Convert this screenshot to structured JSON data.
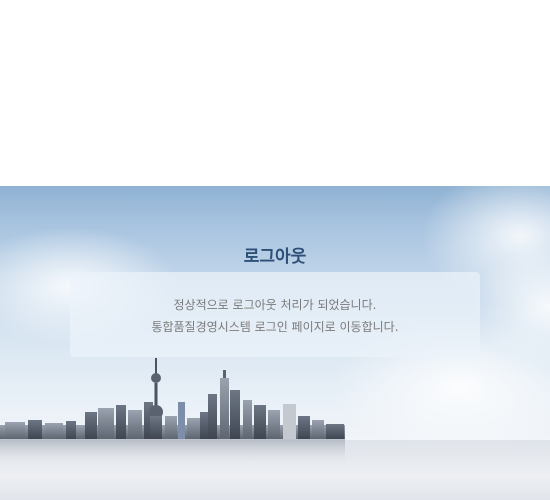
{
  "logout": {
    "title": "로그아웃",
    "message_line1": "정상적으로 로그아웃 처리가 되었습니다.",
    "message_line2": "통합품질경영시스템 로그인 페이지로 이동합니다."
  },
  "colors": {
    "title": "#2d4f78",
    "message_text": "#7a7a7a",
    "sky_top": "#8fb2d3"
  }
}
